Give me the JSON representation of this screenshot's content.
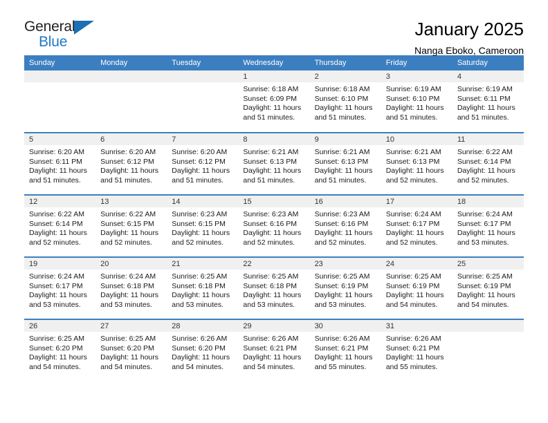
{
  "logo": {
    "line1": "General",
    "line2": "Blue",
    "triangle_icon": "triangle-icon",
    "color_dark": "#231f20",
    "color_blue": "#1f7ac4"
  },
  "header": {
    "title": "January 2025",
    "subtitle": "Nanga Eboko, Cameroon"
  },
  "theme": {
    "header_blue": "#3c7fc1",
    "daynum_band": "#f0f0f0",
    "text": "#1a1a1a"
  },
  "columns": [
    "Sunday",
    "Monday",
    "Tuesday",
    "Wednesday",
    "Thursday",
    "Friday",
    "Saturday"
  ],
  "labels": {
    "sunrise": "Sunrise:",
    "sunset": "Sunset:",
    "daylight": "Daylight:"
  },
  "weeks": [
    [
      {
        "day": "",
        "empty": true
      },
      {
        "day": "",
        "empty": true
      },
      {
        "day": "",
        "empty": true
      },
      {
        "day": "1",
        "sunrise": "Sunrise: 6:18 AM",
        "sunset": "Sunset: 6:09 PM",
        "daylight1": "Daylight: 11 hours",
        "daylight2": "and 51 minutes."
      },
      {
        "day": "2",
        "sunrise": "Sunrise: 6:18 AM",
        "sunset": "Sunset: 6:10 PM",
        "daylight1": "Daylight: 11 hours",
        "daylight2": "and 51 minutes."
      },
      {
        "day": "3",
        "sunrise": "Sunrise: 6:19 AM",
        "sunset": "Sunset: 6:10 PM",
        "daylight1": "Daylight: 11 hours",
        "daylight2": "and 51 minutes."
      },
      {
        "day": "4",
        "sunrise": "Sunrise: 6:19 AM",
        "sunset": "Sunset: 6:11 PM",
        "daylight1": "Daylight: 11 hours",
        "daylight2": "and 51 minutes."
      }
    ],
    [
      {
        "day": "5",
        "sunrise": "Sunrise: 6:20 AM",
        "sunset": "Sunset: 6:11 PM",
        "daylight1": "Daylight: 11 hours",
        "daylight2": "and 51 minutes."
      },
      {
        "day": "6",
        "sunrise": "Sunrise: 6:20 AM",
        "sunset": "Sunset: 6:12 PM",
        "daylight1": "Daylight: 11 hours",
        "daylight2": "and 51 minutes."
      },
      {
        "day": "7",
        "sunrise": "Sunrise: 6:20 AM",
        "sunset": "Sunset: 6:12 PM",
        "daylight1": "Daylight: 11 hours",
        "daylight2": "and 51 minutes."
      },
      {
        "day": "8",
        "sunrise": "Sunrise: 6:21 AM",
        "sunset": "Sunset: 6:13 PM",
        "daylight1": "Daylight: 11 hours",
        "daylight2": "and 51 minutes."
      },
      {
        "day": "9",
        "sunrise": "Sunrise: 6:21 AM",
        "sunset": "Sunset: 6:13 PM",
        "daylight1": "Daylight: 11 hours",
        "daylight2": "and 51 minutes."
      },
      {
        "day": "10",
        "sunrise": "Sunrise: 6:21 AM",
        "sunset": "Sunset: 6:13 PM",
        "daylight1": "Daylight: 11 hours",
        "daylight2": "and 52 minutes."
      },
      {
        "day": "11",
        "sunrise": "Sunrise: 6:22 AM",
        "sunset": "Sunset: 6:14 PM",
        "daylight1": "Daylight: 11 hours",
        "daylight2": "and 52 minutes."
      }
    ],
    [
      {
        "day": "12",
        "sunrise": "Sunrise: 6:22 AM",
        "sunset": "Sunset: 6:14 PM",
        "daylight1": "Daylight: 11 hours",
        "daylight2": "and 52 minutes."
      },
      {
        "day": "13",
        "sunrise": "Sunrise: 6:22 AM",
        "sunset": "Sunset: 6:15 PM",
        "daylight1": "Daylight: 11 hours",
        "daylight2": "and 52 minutes."
      },
      {
        "day": "14",
        "sunrise": "Sunrise: 6:23 AM",
        "sunset": "Sunset: 6:15 PM",
        "daylight1": "Daylight: 11 hours",
        "daylight2": "and 52 minutes."
      },
      {
        "day": "15",
        "sunrise": "Sunrise: 6:23 AM",
        "sunset": "Sunset: 6:16 PM",
        "daylight1": "Daylight: 11 hours",
        "daylight2": "and 52 minutes."
      },
      {
        "day": "16",
        "sunrise": "Sunrise: 6:23 AM",
        "sunset": "Sunset: 6:16 PM",
        "daylight1": "Daylight: 11 hours",
        "daylight2": "and 52 minutes."
      },
      {
        "day": "17",
        "sunrise": "Sunrise: 6:24 AM",
        "sunset": "Sunset: 6:17 PM",
        "daylight1": "Daylight: 11 hours",
        "daylight2": "and 52 minutes."
      },
      {
        "day": "18",
        "sunrise": "Sunrise: 6:24 AM",
        "sunset": "Sunset: 6:17 PM",
        "daylight1": "Daylight: 11 hours",
        "daylight2": "and 53 minutes."
      }
    ],
    [
      {
        "day": "19",
        "sunrise": "Sunrise: 6:24 AM",
        "sunset": "Sunset: 6:17 PM",
        "daylight1": "Daylight: 11 hours",
        "daylight2": "and 53 minutes."
      },
      {
        "day": "20",
        "sunrise": "Sunrise: 6:24 AM",
        "sunset": "Sunset: 6:18 PM",
        "daylight1": "Daylight: 11 hours",
        "daylight2": "and 53 minutes."
      },
      {
        "day": "21",
        "sunrise": "Sunrise: 6:25 AM",
        "sunset": "Sunset: 6:18 PM",
        "daylight1": "Daylight: 11 hours",
        "daylight2": "and 53 minutes."
      },
      {
        "day": "22",
        "sunrise": "Sunrise: 6:25 AM",
        "sunset": "Sunset: 6:18 PM",
        "daylight1": "Daylight: 11 hours",
        "daylight2": "and 53 minutes."
      },
      {
        "day": "23",
        "sunrise": "Sunrise: 6:25 AM",
        "sunset": "Sunset: 6:19 PM",
        "daylight1": "Daylight: 11 hours",
        "daylight2": "and 53 minutes."
      },
      {
        "day": "24",
        "sunrise": "Sunrise: 6:25 AM",
        "sunset": "Sunset: 6:19 PM",
        "daylight1": "Daylight: 11 hours",
        "daylight2": "and 54 minutes."
      },
      {
        "day": "25",
        "sunrise": "Sunrise: 6:25 AM",
        "sunset": "Sunset: 6:19 PM",
        "daylight1": "Daylight: 11 hours",
        "daylight2": "and 54 minutes."
      }
    ],
    [
      {
        "day": "26",
        "sunrise": "Sunrise: 6:25 AM",
        "sunset": "Sunset: 6:20 PM",
        "daylight1": "Daylight: 11 hours",
        "daylight2": "and 54 minutes."
      },
      {
        "day": "27",
        "sunrise": "Sunrise: 6:25 AM",
        "sunset": "Sunset: 6:20 PM",
        "daylight1": "Daylight: 11 hours",
        "daylight2": "and 54 minutes."
      },
      {
        "day": "28",
        "sunrise": "Sunrise: 6:26 AM",
        "sunset": "Sunset: 6:20 PM",
        "daylight1": "Daylight: 11 hours",
        "daylight2": "and 54 minutes."
      },
      {
        "day": "29",
        "sunrise": "Sunrise: 6:26 AM",
        "sunset": "Sunset: 6:21 PM",
        "daylight1": "Daylight: 11 hours",
        "daylight2": "and 54 minutes."
      },
      {
        "day": "30",
        "sunrise": "Sunrise: 6:26 AM",
        "sunset": "Sunset: 6:21 PM",
        "daylight1": "Daylight: 11 hours",
        "daylight2": "and 55 minutes."
      },
      {
        "day": "31",
        "sunrise": "Sunrise: 6:26 AM",
        "sunset": "Sunset: 6:21 PM",
        "daylight1": "Daylight: 11 hours",
        "daylight2": "and 55 minutes."
      },
      {
        "day": "",
        "empty": true
      }
    ]
  ]
}
